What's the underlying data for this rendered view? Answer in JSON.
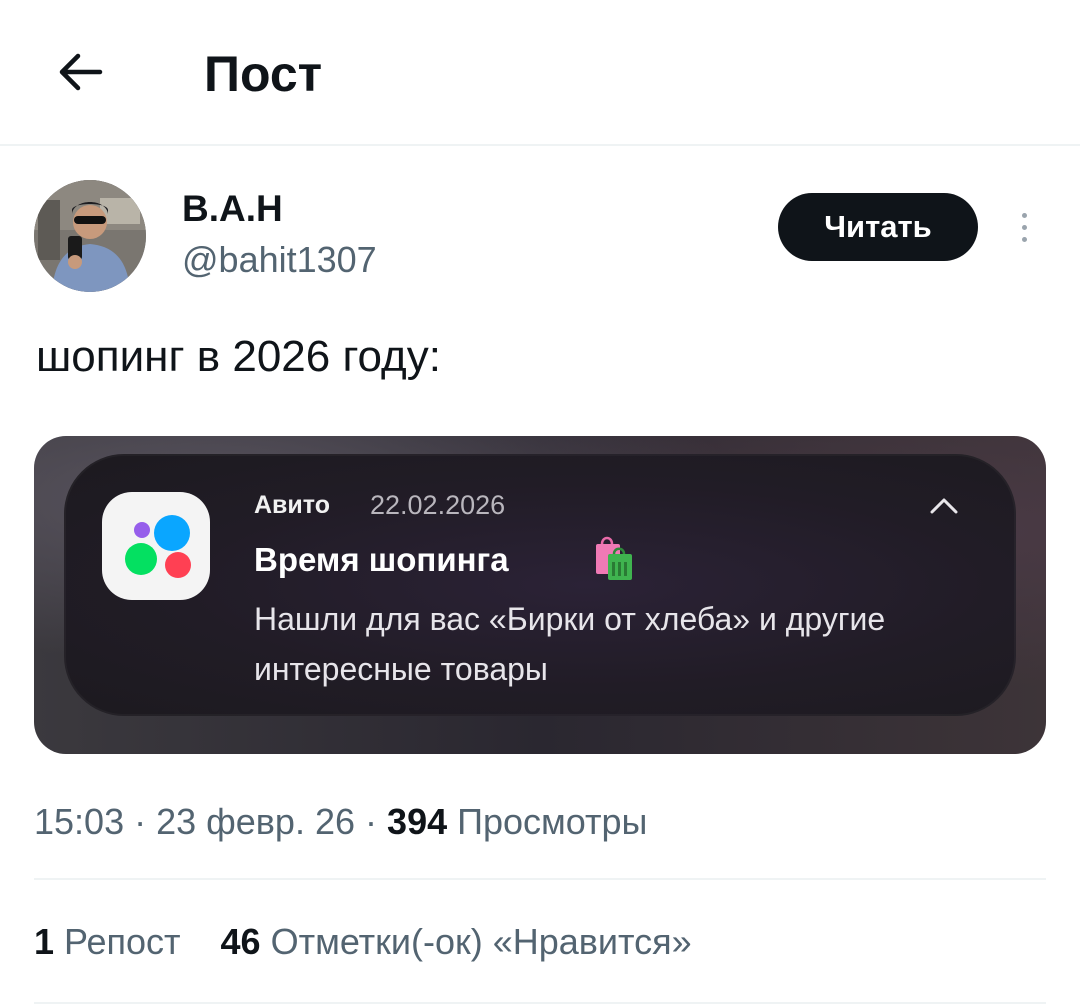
{
  "header": {
    "title": "Пост"
  },
  "author": {
    "name": "В.А.Н",
    "handle": "@bahit1307",
    "follow_label": "Читать"
  },
  "post": {
    "text": "шопинг в 2026 году:"
  },
  "notification": {
    "app": "Авито",
    "date": "22.02.2026",
    "title": "Время шопинга",
    "body": "Нашли для вас «Бирки от хлеба» и другие интересные товары",
    "icon": "avito-icon",
    "emoji_icon": "shopping-bags-icon"
  },
  "meta": {
    "time": "15:03",
    "date": "23 февр. 26",
    "views_count": "394",
    "views_label": "Просмотры",
    "separator": "·"
  },
  "stats": {
    "reposts_count": "1",
    "reposts_label": "Репост",
    "likes_count": "46",
    "likes_label": "Отметки(-ок) «Нравится»"
  },
  "colors": {
    "text_primary": "#0f1419",
    "text_secondary": "#536471",
    "divider": "#eff3f4",
    "avito_blue": "#0aa6ff",
    "avito_green": "#04e061",
    "avito_red": "#ff4053",
    "avito_purple": "#965eeb"
  }
}
